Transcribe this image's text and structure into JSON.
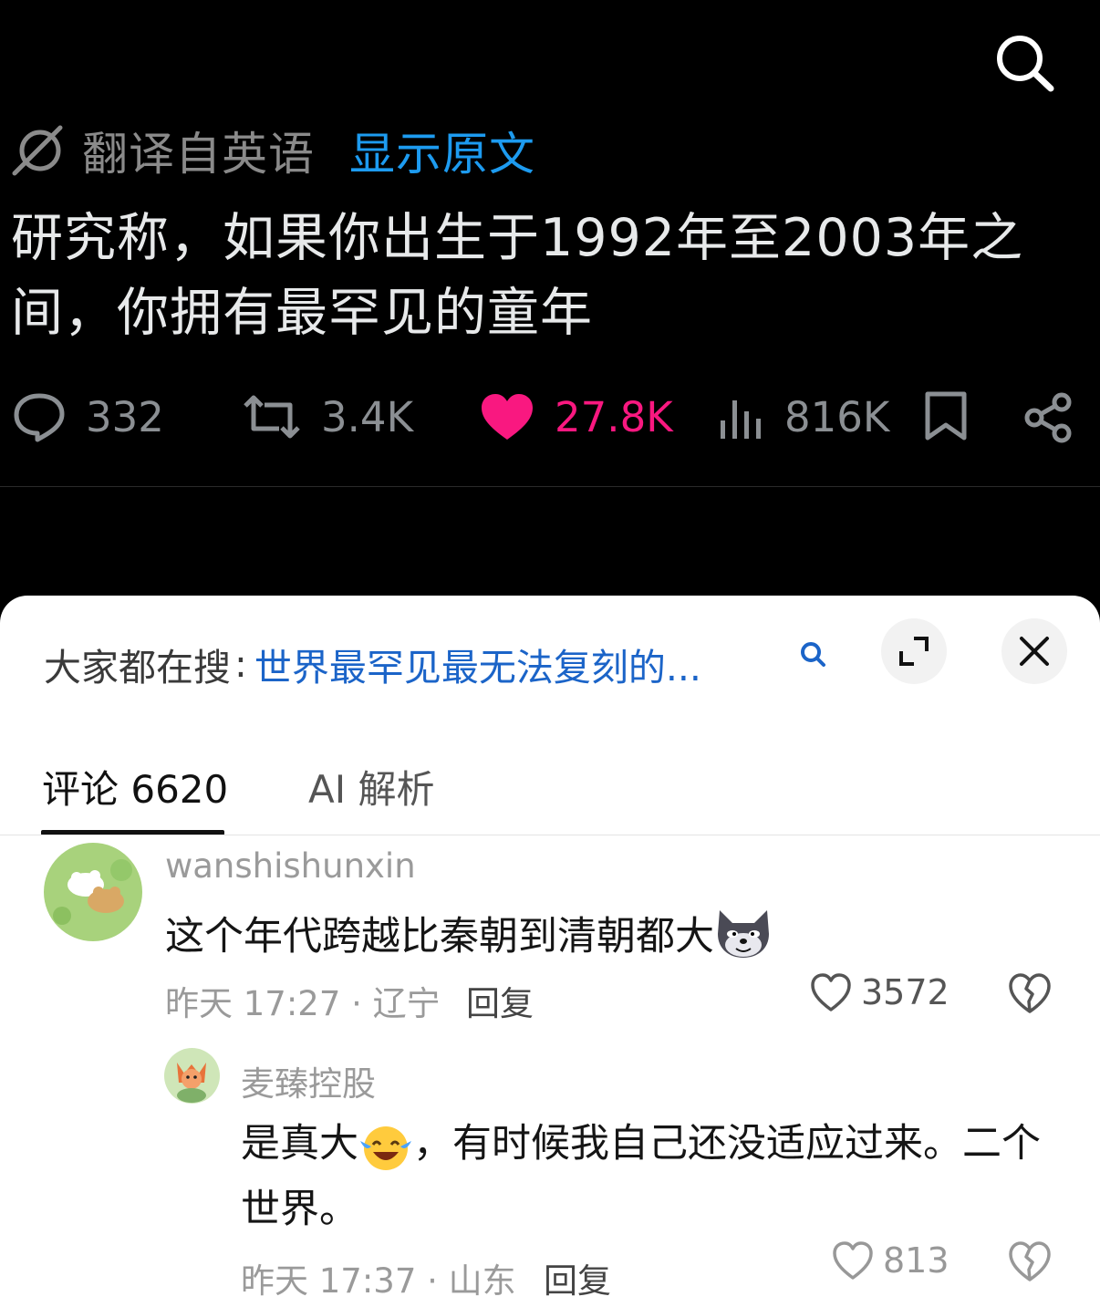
{
  "tweet": {
    "translate_label": "翻译自英语",
    "show_original": "显示原文",
    "text": "研究称，如果你出生于1992年至2003年之间，你拥有最罕见的童年",
    "stats": {
      "replies": "332",
      "retweets": "3.4K",
      "likes": "27.8K",
      "views": "816K"
    }
  },
  "sheet": {
    "hot_search_prefix": "大家都在搜",
    "hot_search_colon": ":",
    "hot_search_query": "世界最罕见最无法复刻的...",
    "tabs": [
      {
        "label": "评论 6620"
      },
      {
        "label": "AI 解析"
      }
    ]
  },
  "comments": [
    {
      "username": "wanshishunxin",
      "text": "这个年代跨越比秦朝到清朝都大",
      "time_location": "昨天 17:27 · 辽宁",
      "reply_label": "回复",
      "likes": "3572",
      "emoji": "wolf-emoji"
    },
    {
      "username": "麦臻控股",
      "text_before_emoji": "是真大",
      "text_after_emoji": "，有时候我自己还没适应过来。二个世界。",
      "time_location": "昨天 17:37 · 山东",
      "reply_label": "回复",
      "likes": "813",
      "emoji": "laughing-tears-emoji"
    }
  ],
  "colors": {
    "accent_blue": "#1d9bf0",
    "like_pink": "#f91880",
    "query_blue": "#1b64c8"
  }
}
